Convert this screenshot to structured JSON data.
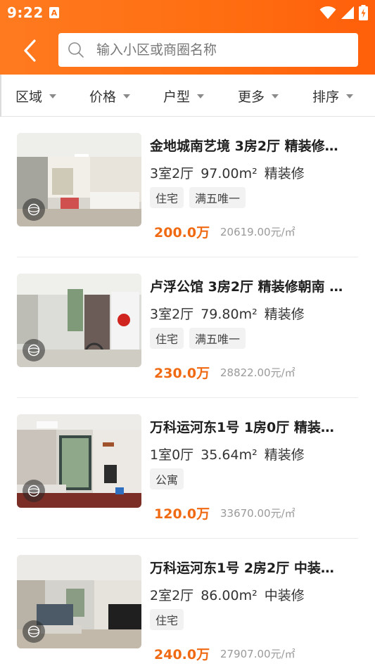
{
  "status_bar": {
    "time": "9:22",
    "sim_label": "A"
  },
  "header": {
    "search_placeholder": "输入小区或商圈名称"
  },
  "filters": [
    "区域",
    "价格",
    "户型",
    "更多",
    "排序"
  ],
  "listings": [
    {
      "title": "金地城南艺境 3房2厅  精装修…",
      "rooms": "3室2厅",
      "area": "97.00m²",
      "decor": "精装修",
      "tags": [
        "住宅",
        "满五唯一"
      ],
      "price": "200.0万",
      "unit_price": "20619.00元/㎡"
    },
    {
      "title": "卢浮公馆 3房2厅  精装修朝南 …",
      "rooms": "3室2厅",
      "area": "79.80m²",
      "decor": "精装修",
      "tags": [
        "住宅",
        "满五唯一"
      ],
      "price": "230.0万",
      "unit_price": "28822.00元/㎡"
    },
    {
      "title": "万科运河东1号 1房0厅  精装…",
      "rooms": "1室0厅",
      "area": "35.64m²",
      "decor": "精装修",
      "tags": [
        "公寓"
      ],
      "price": "120.0万",
      "unit_price": "33670.00元/㎡"
    },
    {
      "title": "万科运河东1号 2房2厅  中装…",
      "rooms": "2室2厅",
      "area": "86.00m²",
      "decor": "中装修",
      "tags": [
        "住宅"
      ],
      "price": "240.0万",
      "unit_price": "27907.00元/㎡"
    }
  ],
  "colors": {
    "accent": "#ff6f12",
    "price": "#f06a14"
  }
}
